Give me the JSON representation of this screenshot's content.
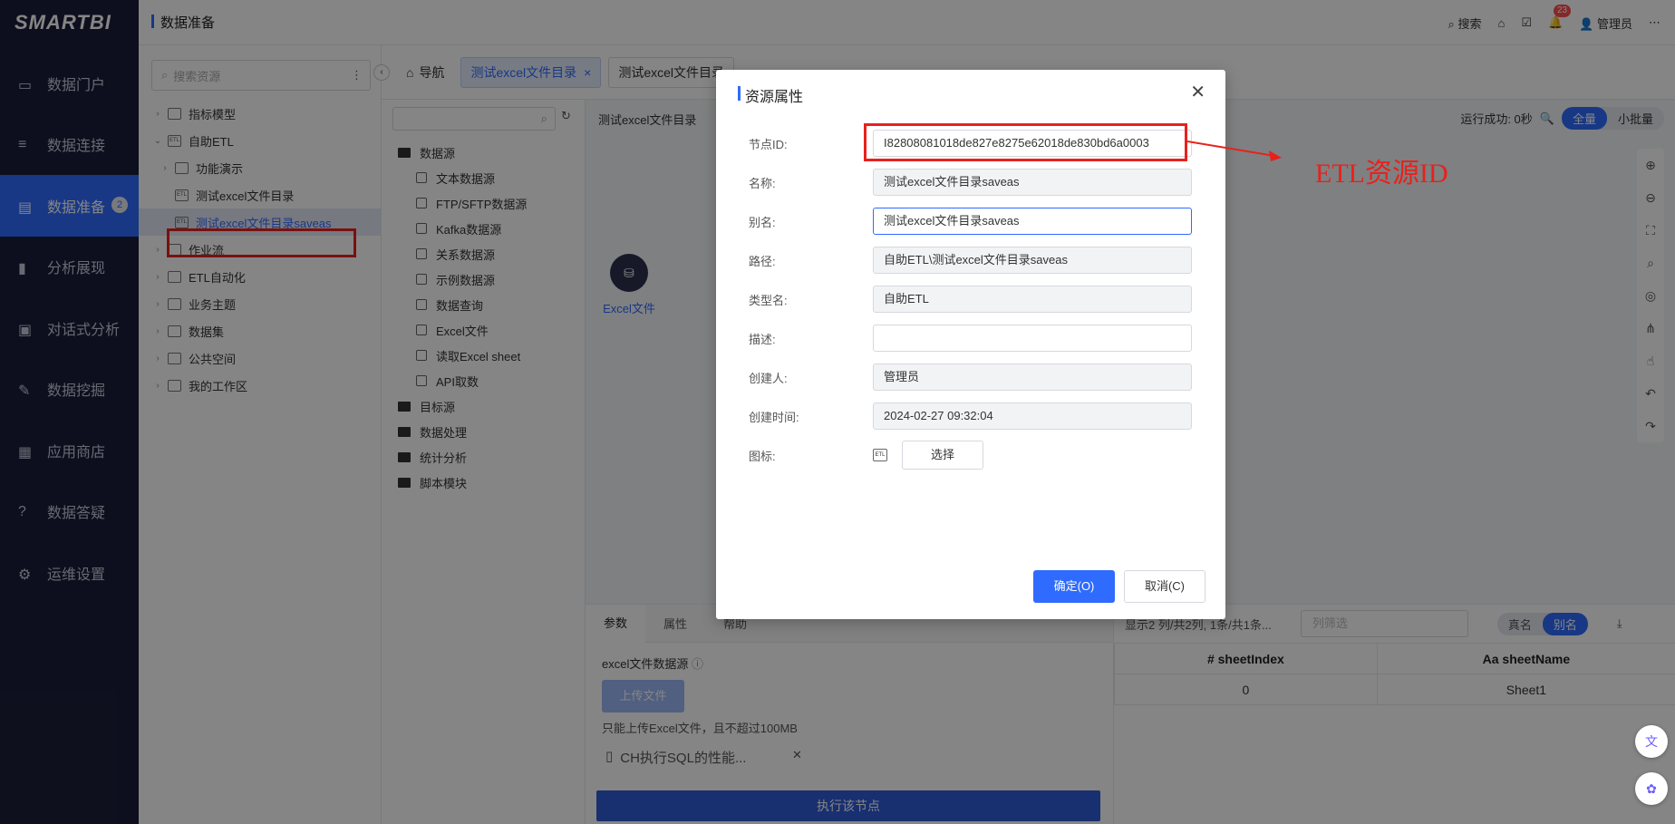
{
  "app": {
    "logo": "SMARTBI",
    "page_title": "数据准备"
  },
  "nav": {
    "items": [
      {
        "label": "数据门户",
        "icon": "monitor-icon"
      },
      {
        "label": "数据连接",
        "icon": "database-icon"
      },
      {
        "label": "数据准备",
        "icon": "server-icon",
        "badge": "2",
        "active": true
      },
      {
        "label": "分析展现",
        "icon": "bar-chart-icon"
      },
      {
        "label": "对话式分析",
        "icon": "chat-icon"
      },
      {
        "label": "数据挖掘",
        "icon": "pickaxe-icon"
      },
      {
        "label": "应用商店",
        "icon": "grid-icon"
      },
      {
        "label": "数据答疑",
        "icon": "question-icon"
      },
      {
        "label": "运维设置",
        "icon": "gear-icon"
      }
    ]
  },
  "topbar": {
    "search": "搜索",
    "notifications": "23",
    "user": "管理员"
  },
  "tree": {
    "search_placeholder": "搜索资源",
    "items": [
      {
        "label": "指标模型"
      },
      {
        "label": "自助ETL"
      },
      {
        "label": "功能演示"
      },
      {
        "label": "测试excel文件目录"
      },
      {
        "label": "测试excel文件目录saveas"
      },
      {
        "label": "作业流"
      },
      {
        "label": "ETL自动化"
      },
      {
        "label": "业务主题"
      },
      {
        "label": "数据集"
      },
      {
        "label": "公共空间"
      },
      {
        "label": "我的工作区"
      }
    ]
  },
  "tabs": {
    "nav": "导航",
    "active": "测试excel文件目录",
    "second": "测试excel文件目录"
  },
  "components": {
    "groups": [
      "数据源",
      "目标源",
      "数据处理",
      "统计分析",
      "脚本模块"
    ],
    "datasource_items": [
      "文本数据源",
      "FTP/SFTP数据源",
      "Kafka数据源",
      "关系数据源",
      "示例数据源",
      "数据查询",
      "Excel文件",
      "读取Excel sheet",
      "API取数"
    ]
  },
  "canvas": {
    "header": "测试excel文件目录",
    "status": "运行成功: 0秒",
    "mode_full": "全量",
    "mode_batch": "小批量",
    "node_label": "Excel文件"
  },
  "bottom": {
    "tabs": [
      "参数",
      "属性",
      "帮助"
    ],
    "param_label": "excel文件数据源",
    "upload_button": "上传文件",
    "upload_hint": "只能上传Excel文件，且不超过100MB",
    "file_name": "CH执行SQL的性能...",
    "run_button": "执行该节点",
    "result_info": "显示2 列/共2列, 1条/共1条...",
    "filter_placeholder": "列筛选",
    "toggle_real": "真名",
    "toggle_alias": "别名",
    "columns": [
      "# sheetIndex",
      "Aa sheetName"
    ],
    "rows": [
      [
        "0",
        "Sheet1"
      ]
    ]
  },
  "dialog": {
    "title": "资源属性",
    "fields": {
      "node_id_label": "节点ID:",
      "node_id": "I82808081018de827e8275e62018de830bd6a0003",
      "name_label": "名称:",
      "name": "测试excel文件目录saveas",
      "alias_label": "别名:",
      "alias": "测试excel文件目录saveas",
      "path_label": "路径:",
      "path": "自助ETL\\测试excel文件目录saveas",
      "type_label": "类型名:",
      "type": "自助ETL",
      "desc_label": "描述:",
      "desc": "",
      "creator_label": "创建人:",
      "creator": "管理员",
      "created_label": "创建时间:",
      "created": "2024-02-27 09:32:04",
      "icon_label": "图标:",
      "choose_button": "选择"
    },
    "ok": "确定(O)",
    "cancel": "取消(C)"
  },
  "annotation": {
    "text": "ETL资源ID",
    "color": "#e8211c"
  },
  "colors": {
    "accent": "#2f6bff",
    "nav_bg": "#1a1e3a",
    "highlight": "#e8211c"
  }
}
